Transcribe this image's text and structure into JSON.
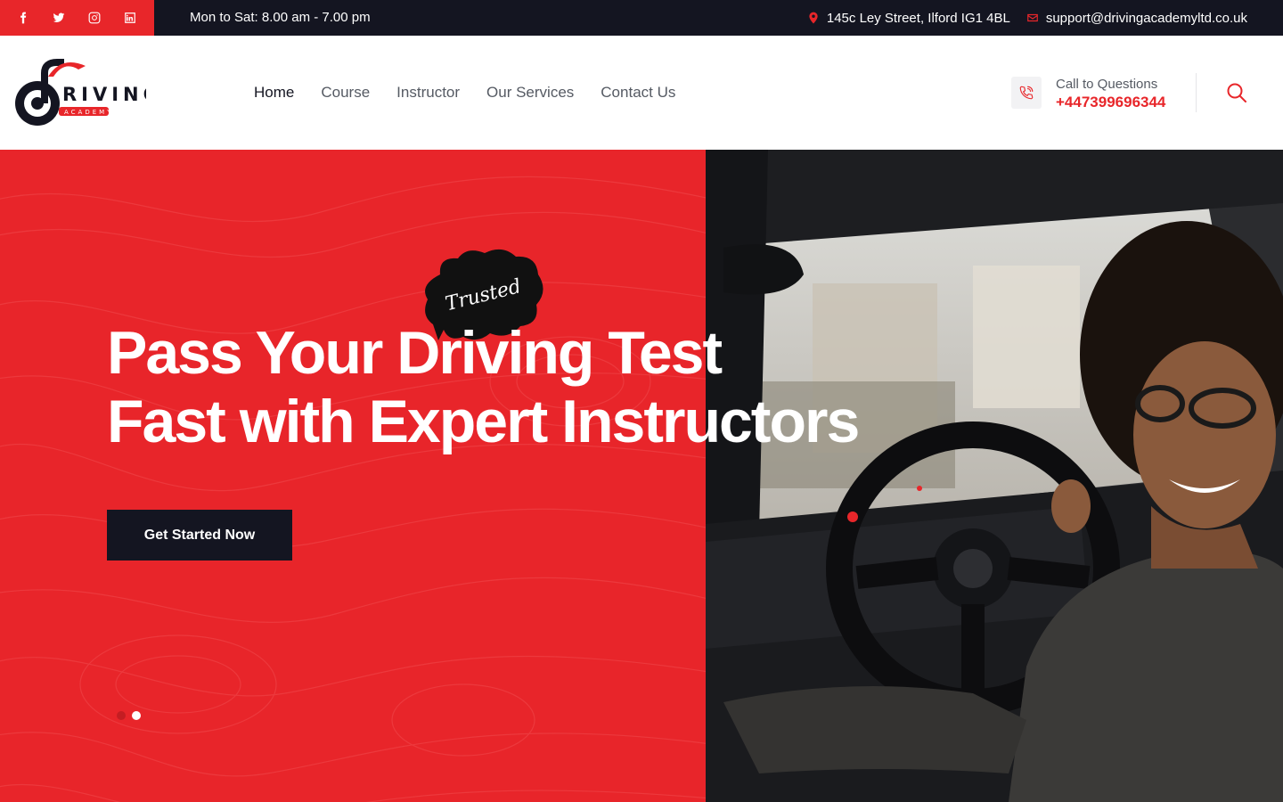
{
  "topbar": {
    "social": [
      {
        "icon": "facebook-icon"
      },
      {
        "icon": "twitter-icon"
      },
      {
        "icon": "instagram-icon"
      },
      {
        "icon": "linkedin-icon"
      }
    ],
    "hours": "Mon to Sat: 8.00 am - 7.00 pm",
    "address": "145c Ley Street, Ilford IG1 4BL",
    "email": "support@drivingacademyltd.co.uk"
  },
  "header": {
    "logo_text": "RIVING",
    "logo_sub": "ACADEMY",
    "nav": [
      {
        "label": "Home"
      },
      {
        "label": "Course"
      },
      {
        "label": "Instructor"
      },
      {
        "label": "Our Services"
      },
      {
        "label": "Contact Us"
      }
    ],
    "call_label": "Call to Questions",
    "call_number": "+447399696344"
  },
  "hero": {
    "badge": "Trusted",
    "title_line1": "Pass Your Driving Test",
    "title_line2": "Fast with Expert Instructors",
    "cta": "Get Started Now",
    "slides": 2,
    "active_slide": 2
  },
  "colors": {
    "accent": "#e8262a",
    "dark": "#141521"
  }
}
